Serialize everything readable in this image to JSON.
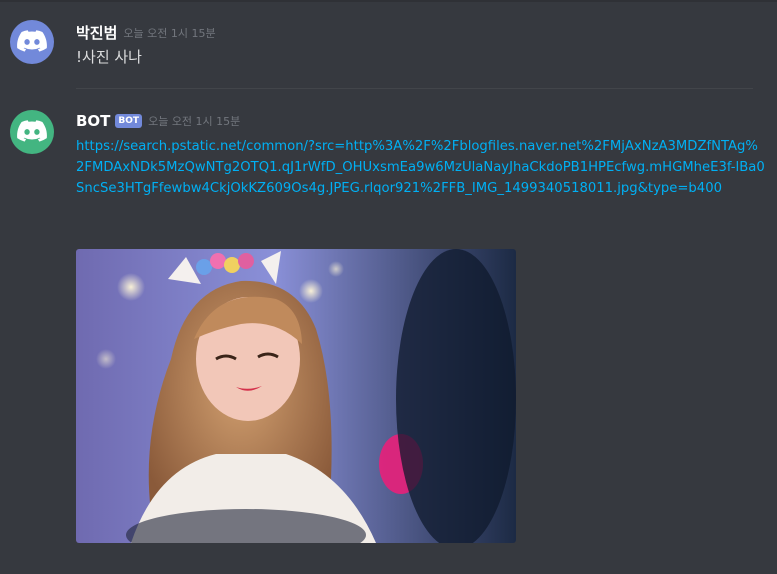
{
  "messages": [
    {
      "username": "박진범",
      "timestamp": "오늘 오전 1시 15분",
      "text": "!사진 사나",
      "avatar_icon": "discord-logo-icon",
      "avatar_color": "#7289da"
    },
    {
      "username": "BOT",
      "bot_tag": "BOT",
      "timestamp": "오늘 오전 1시 15분",
      "link": "https://search.pstatic.net/common/?src=http%3A%2F%2Fblogfiles.naver.net%2FMjAxNzA3MDZfNTAg%2FMDAxNDk5MzQwNTg2OTQ1.qJ1rWfD_OHUxsmEa9w6MzUlaNayJhaCkdoPB1HPEcfwg.mHGMheE3f-lBa0SncSe3HTgFfewbw4CkjOkKZ609Os4g.JPEG.rlqor921%2FFB_IMG_1499340518011.jpg&type=b400",
      "avatar_icon": "discord-logo-icon",
      "avatar_color": "#43b581"
    }
  ],
  "colors": {
    "background": "#36393f",
    "link": "#00b0f4",
    "timestamp": "#72767d",
    "bot_tag": "#7289da"
  }
}
